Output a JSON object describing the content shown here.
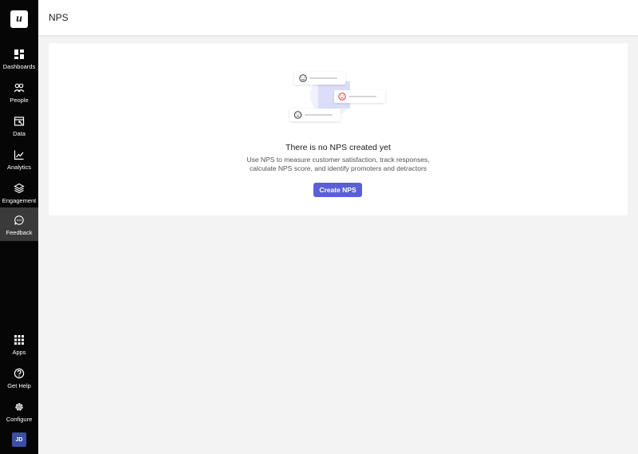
{
  "app": {
    "logo_letter": "u"
  },
  "sidebar": {
    "items": [
      {
        "label": "Dashboards",
        "icon": "dashboard-icon"
      },
      {
        "label": "People",
        "icon": "people-icon"
      },
      {
        "label": "Data",
        "icon": "data-icon"
      },
      {
        "label": "Analytics",
        "icon": "analytics-icon"
      },
      {
        "label": "Engagement",
        "icon": "engagement-icon"
      },
      {
        "label": "Feedback",
        "icon": "feedback-icon",
        "active": true
      }
    ],
    "bottom_items": [
      {
        "label": "Apps",
        "icon": "apps-grid-icon"
      },
      {
        "label": "Get Help",
        "icon": "help-icon"
      },
      {
        "label": "Configure",
        "icon": "gear-icon"
      }
    ],
    "avatar_initials": "JD"
  },
  "header": {
    "title": "NPS"
  },
  "empty_state": {
    "title": "There is no NPS created yet",
    "description_line1": "Use NPS to measure customer satisfaction, track responses,",
    "description_line2": "calculate NPS score, and identify promoters and detractors",
    "button_label": "Create NPS"
  },
  "colors": {
    "sidebar_bg": "#060606",
    "sidebar_active_bg": "#3a3a3a",
    "accent": "#5a5fd9",
    "avatar_bg": "#3b4fa8",
    "detractor_red": "#e0303a"
  }
}
